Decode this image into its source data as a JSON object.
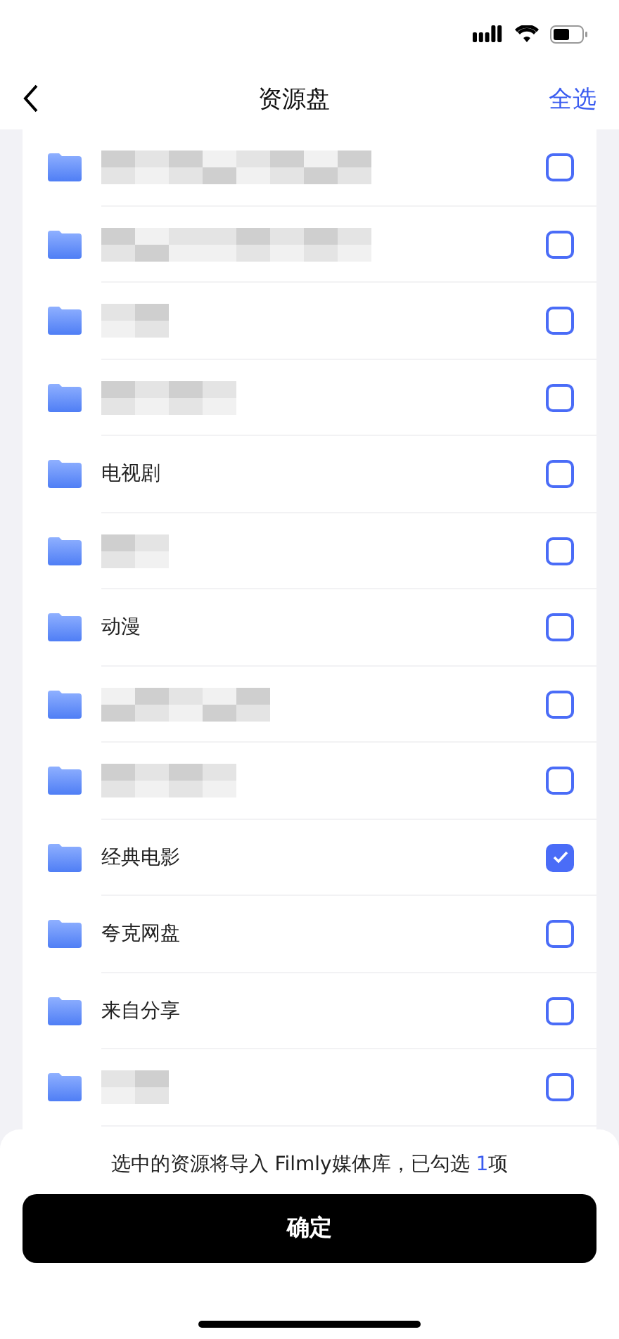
{
  "nav": {
    "title": "资源盘",
    "action": "全选"
  },
  "folders": [
    {
      "kind": "redacted",
      "checked": false
    },
    {
      "kind": "redacted",
      "checked": false
    },
    {
      "kind": "redacted",
      "checked": false
    },
    {
      "kind": "redacted",
      "checked": false
    },
    {
      "kind": "named",
      "name": "电视剧",
      "checked": false
    },
    {
      "kind": "redacted",
      "checked": false
    },
    {
      "kind": "named",
      "name": "动漫",
      "checked": false
    },
    {
      "kind": "redacted",
      "checked": false
    },
    {
      "kind": "redacted",
      "checked": false
    },
    {
      "kind": "named",
      "name": "经典电影",
      "checked": true
    },
    {
      "kind": "named",
      "name": "夸克网盘",
      "checked": false
    },
    {
      "kind": "named",
      "name": "来自分享",
      "checked": false
    },
    {
      "kind": "redacted",
      "checked": false
    }
  ],
  "summary": {
    "before": "选中的资源将导入 Filmly媒体库，已勾选 ",
    "count": "1",
    "after": "项"
  },
  "confirm": "确定"
}
